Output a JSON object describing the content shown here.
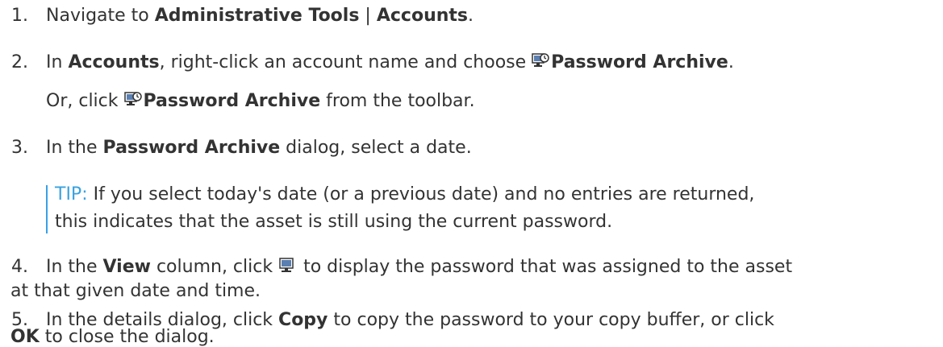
{
  "steps": [
    {
      "number": "1.",
      "parts": {
        "a": "Navigate to ",
        "b": "Administrative Tools",
        "c": " | ",
        "d": "Accounts",
        "e": "."
      }
    },
    {
      "number": "2.",
      "parts": {
        "a": "In ",
        "b": "Accounts",
        "c": ", right-click an account name and choose ",
        "d": "Password Archive",
        "e": "."
      },
      "alt": {
        "a": "Or, click ",
        "b": "Password Archive",
        "c": " from the toolbar."
      }
    },
    {
      "number": "3.",
      "parts": {
        "a": "In the ",
        "b": "Password Archive",
        "c": " dialog, select a date."
      },
      "tip": {
        "label": "TIP:",
        "line1": " If you select today's date (or a previous date) and no entries are returned,",
        "line2": "this indicates that the asset is still using the current password."
      }
    },
    {
      "number": "4.",
      "parts": {
        "a": "In the ",
        "b": "View",
        "c": " column, click ",
        "d": " to display the password that was assigned to the asset"
      },
      "line2": "at that given date and time."
    },
    {
      "number": "5.",
      "parts": {
        "a": "In the details dialog, click ",
        "b": "Copy",
        "c": " to copy the password to your copy buffer, or click"
      },
      "line2": {
        "b": "OK",
        "c": " to close the dialog."
      }
    }
  ],
  "icons": {
    "archive_icon": "password-archive-icon",
    "view_icon": "view-password-icon"
  }
}
